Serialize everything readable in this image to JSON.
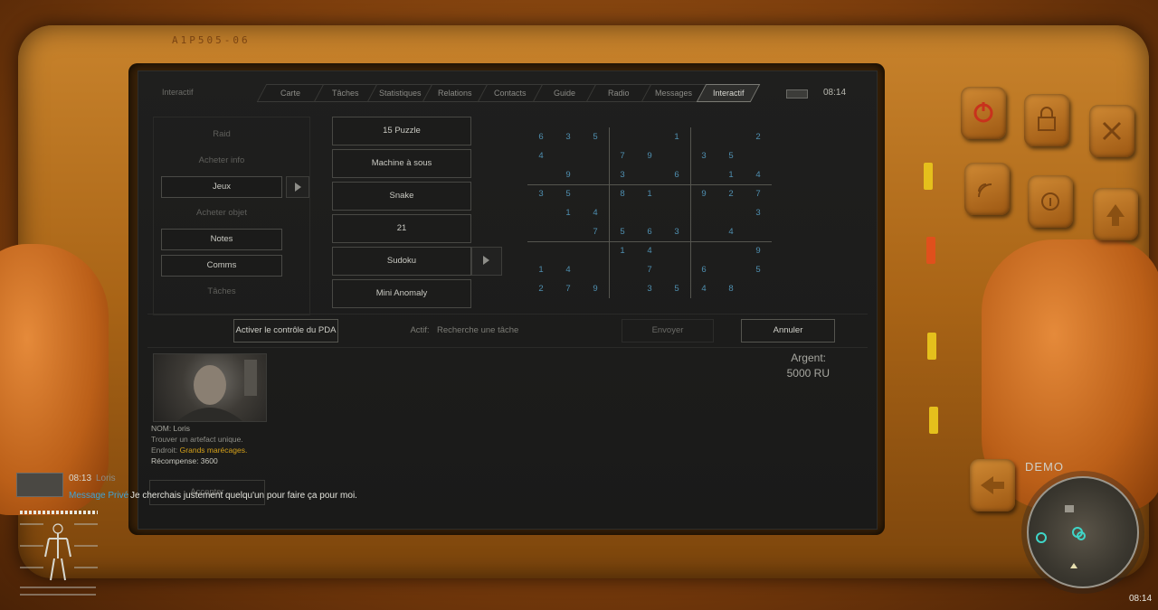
{
  "device": {
    "label": "A1P505-06"
  },
  "pda": {
    "section_label": "Interactif",
    "clock": "08:14",
    "tabs": [
      {
        "label": "Carte",
        "active": false
      },
      {
        "label": "Tâches",
        "active": false
      },
      {
        "label": "Statistiques",
        "active": false
      },
      {
        "label": "Relations",
        "active": false
      },
      {
        "label": "Contacts",
        "active": false
      },
      {
        "label": "Guide",
        "active": false
      },
      {
        "label": "Radio",
        "active": false
      },
      {
        "label": "Messages",
        "active": false
      },
      {
        "label": "Interactif",
        "active": true
      }
    ],
    "menu": [
      {
        "label": "Raid",
        "enabled": false
      },
      {
        "label": "Acheter info",
        "enabled": false
      },
      {
        "label": "Jeux",
        "enabled": true
      },
      {
        "label": "Acheter objet",
        "enabled": false
      },
      {
        "label": "Notes",
        "enabled": true
      },
      {
        "label": "Comms",
        "enabled": true
      },
      {
        "label": "Tâches",
        "enabled": false
      }
    ],
    "games": [
      "15 Puzzle",
      "Machine à sous",
      "Snake",
      "21",
      "Sudoku",
      "Mini Anomaly"
    ],
    "sudoku": [
      [
        "6",
        "3",
        "5",
        "",
        "",
        "1",
        "",
        "",
        "2"
      ],
      [
        "4",
        "",
        "",
        "7",
        "9",
        "",
        "3",
        "5",
        ""
      ],
      [
        "",
        "9",
        "",
        "3",
        "",
        "6",
        "",
        "1",
        "4"
      ],
      [
        "3",
        "5",
        "",
        "8",
        "1",
        "",
        "9",
        "2",
        "7"
      ],
      [
        "",
        "1",
        "4",
        "",
        "",
        "",
        "",
        "",
        "3"
      ],
      [
        "",
        "",
        "7",
        "5",
        "6",
        "3",
        "",
        "4",
        ""
      ],
      [
        "",
        "",
        "",
        "1",
        "4",
        "",
        "",
        "",
        "9"
      ],
      [
        "1",
        "4",
        "",
        "",
        "7",
        "",
        "6",
        "",
        "5"
      ],
      [
        "2",
        "7",
        "9",
        "",
        "3",
        "5",
        "4",
        "8",
        ""
      ]
    ],
    "actions": {
      "pda_control": "Activer le contrôle du PDA",
      "active_label": "Actif:",
      "active_value": "Recherche une tâche",
      "send": "Envoyer",
      "cancel": "Annuler"
    },
    "profile": {
      "name_line": "NOM: Loris",
      "task_line": "Trouver un artefact unique.",
      "place_label": "Endroit:",
      "place_value": "Grands marécages.",
      "reward_line": "Récompense: 3600",
      "accept": "Accepter"
    },
    "money_label": "Argent:",
    "money_value": "5000 RU"
  },
  "hud": {
    "chat_time": "08:13",
    "chat_name": "Loris",
    "chat_tag": "Message Privé",
    "chat_message": "Je cherchais justement quelqu'un pour faire ça pour moi.",
    "demo_label": "DEMO",
    "clock": "08:14"
  },
  "colors": {
    "sudoku_digit": "#4f8fb0",
    "chat_tag": "#3fa3d6",
    "place_value": "#d6a21a",
    "led_yellow": "#e5c01c",
    "led_red": "#e0501c"
  }
}
